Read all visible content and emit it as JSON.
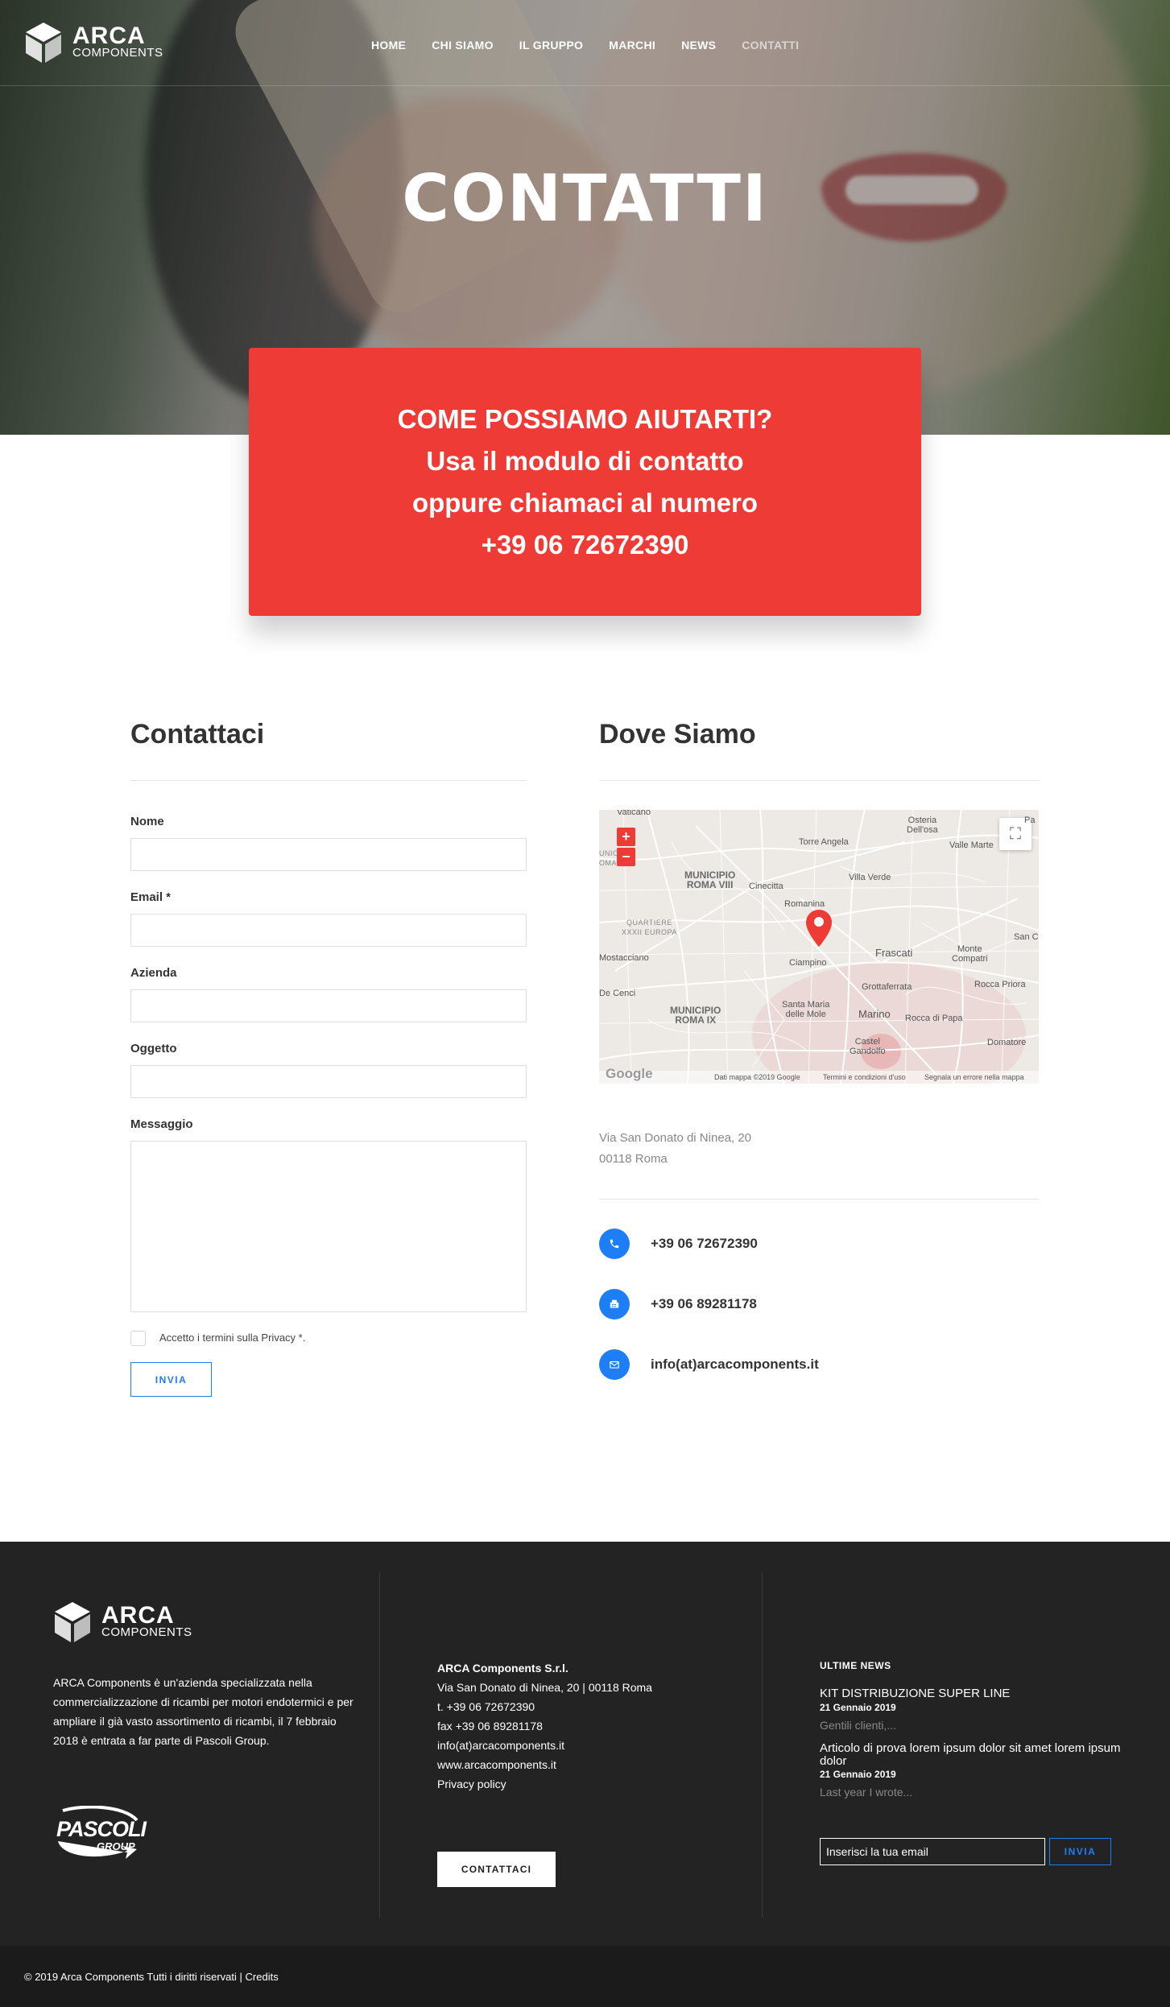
{
  "brand": {
    "name": "ARCA",
    "subtitle": "COMPONENTS",
    "accent_color": "#ee3b35",
    "link_color": "#1d7ef5"
  },
  "nav": {
    "items": [
      {
        "label": "HOME"
      },
      {
        "label": "CHI SIAMO"
      },
      {
        "label": "IL GRUPPO"
      },
      {
        "label": "MARCHI"
      },
      {
        "label": "NEWS"
      },
      {
        "label": "CONTATTI",
        "active": true
      }
    ]
  },
  "hero": {
    "title": "CONTATTI"
  },
  "help_box": {
    "lines": [
      "COME POSSIAMO AIUTARTI?",
      "Usa il modulo di contatto",
      "oppure chiamaci al numero",
      "+39 06 72672390"
    ]
  },
  "contact_form": {
    "title": "Contattaci",
    "fields": {
      "name": {
        "label": "Nome",
        "value": ""
      },
      "email": {
        "label": "Email *",
        "value": ""
      },
      "company": {
        "label": "Azienda",
        "value": ""
      },
      "subject": {
        "label": "Oggetto",
        "value": ""
      },
      "message": {
        "label": "Messaggio",
        "value": ""
      }
    },
    "privacy_label": "Accetto i termini sulla Privacy *.",
    "submit_label": "INVIA"
  },
  "location": {
    "title": "Dove Siamo",
    "map": {
      "zoom_in": "+",
      "zoom_out": "−",
      "fullscreen_icon": "fullscreen-icon",
      "labels": {
        "vaticano": "Vaticano",
        "osteria": "Osteria\nDell'osa",
        "pa": "Pa",
        "torre_angela": "Torre Angela",
        "valle_marte": "Valle Marte",
        "municipio_viii": "MUNICIPIO\nROMA VIII",
        "cinecitta": "Cinecitta",
        "villa_verde": "Villa Verde",
        "romanina": "Romanina",
        "quartiere": "QUARTIERE\nXXXII EUROPA",
        "mostacciano": "Mostacciano",
        "ciampino": "Ciampino",
        "frascati": "Frascati",
        "monte_compatri": "Monte\nCompatri",
        "san_ce": "San Ce",
        "de_cenci": "De Cenci",
        "grottaferrata": "Grottaferrata",
        "rocca_priora": "Rocca Priora",
        "municipio_ix": "MUNICIPIO\nROMA IX",
        "santa_maria": "Santa Maria\ndelle Mole",
        "marino": "Marino",
        "rocca_di_papa": "Rocca di Papa",
        "castel_gandolfo": "Castel\nGandolfo",
        "domatore": "Domatore",
        "omunicipio": "UNIC\nOMA"
      },
      "google": "Google",
      "attribution": "Dati mappa ©2019 Google",
      "terms": "Termini e condizioni d'uso",
      "report": "Segnala un errore nella mappa"
    },
    "address_line1": "Via San Donato di Ninea, 20",
    "address_line2": "00118 Roma",
    "contacts": [
      {
        "icon": "phone-icon",
        "text": "+39 06 72672390"
      },
      {
        "icon": "fax-icon",
        "text": "+39 06 89281178"
      },
      {
        "icon": "mail-icon",
        "text": "info(at)arcacomponents.it"
      }
    ]
  },
  "footer": {
    "about": "ARCA Components è un'azienda specializzata nella commercializzazione di ricambi per motori endotermici e per ampliare il già vasto assortimento di ricambi, il 7 febbraio 2018 è entrata a far parte di Pascoli Group.",
    "group_logo": "PASCOLI",
    "group_logo_sub": "GROUP",
    "company": {
      "name": "ARCA Components S.r.l.",
      "address": "Via San Donato di Ninea, 20 | 00118 Roma",
      "tel": "t. +39 06 72672390",
      "fax": "fax +39 06 89281178",
      "email": "info(at)arcacomponents.it",
      "web": "www.arcacomponents.it",
      "privacy": "Privacy policy"
    },
    "cta_label": "CONTATTACI",
    "news": {
      "heading": "ULTIME NEWS",
      "items": [
        {
          "title": "KIT DISTRIBUZIONE SUPER LINE",
          "date": "21 Gennaio 2019",
          "excerpt": "Gentili clienti,..."
        },
        {
          "title": "Articolo di prova lorem ipsum dolor sit amet lorem ipsum dolor",
          "date": "21 Gennaio 2019",
          "excerpt": "Last year I wrote..."
        }
      ]
    },
    "newsletter": {
      "placeholder": "Inserisci la tua email",
      "button": "INVIA"
    },
    "copyright": "© 2019 Arca Components Tutti i diritti riservati | Credits"
  }
}
